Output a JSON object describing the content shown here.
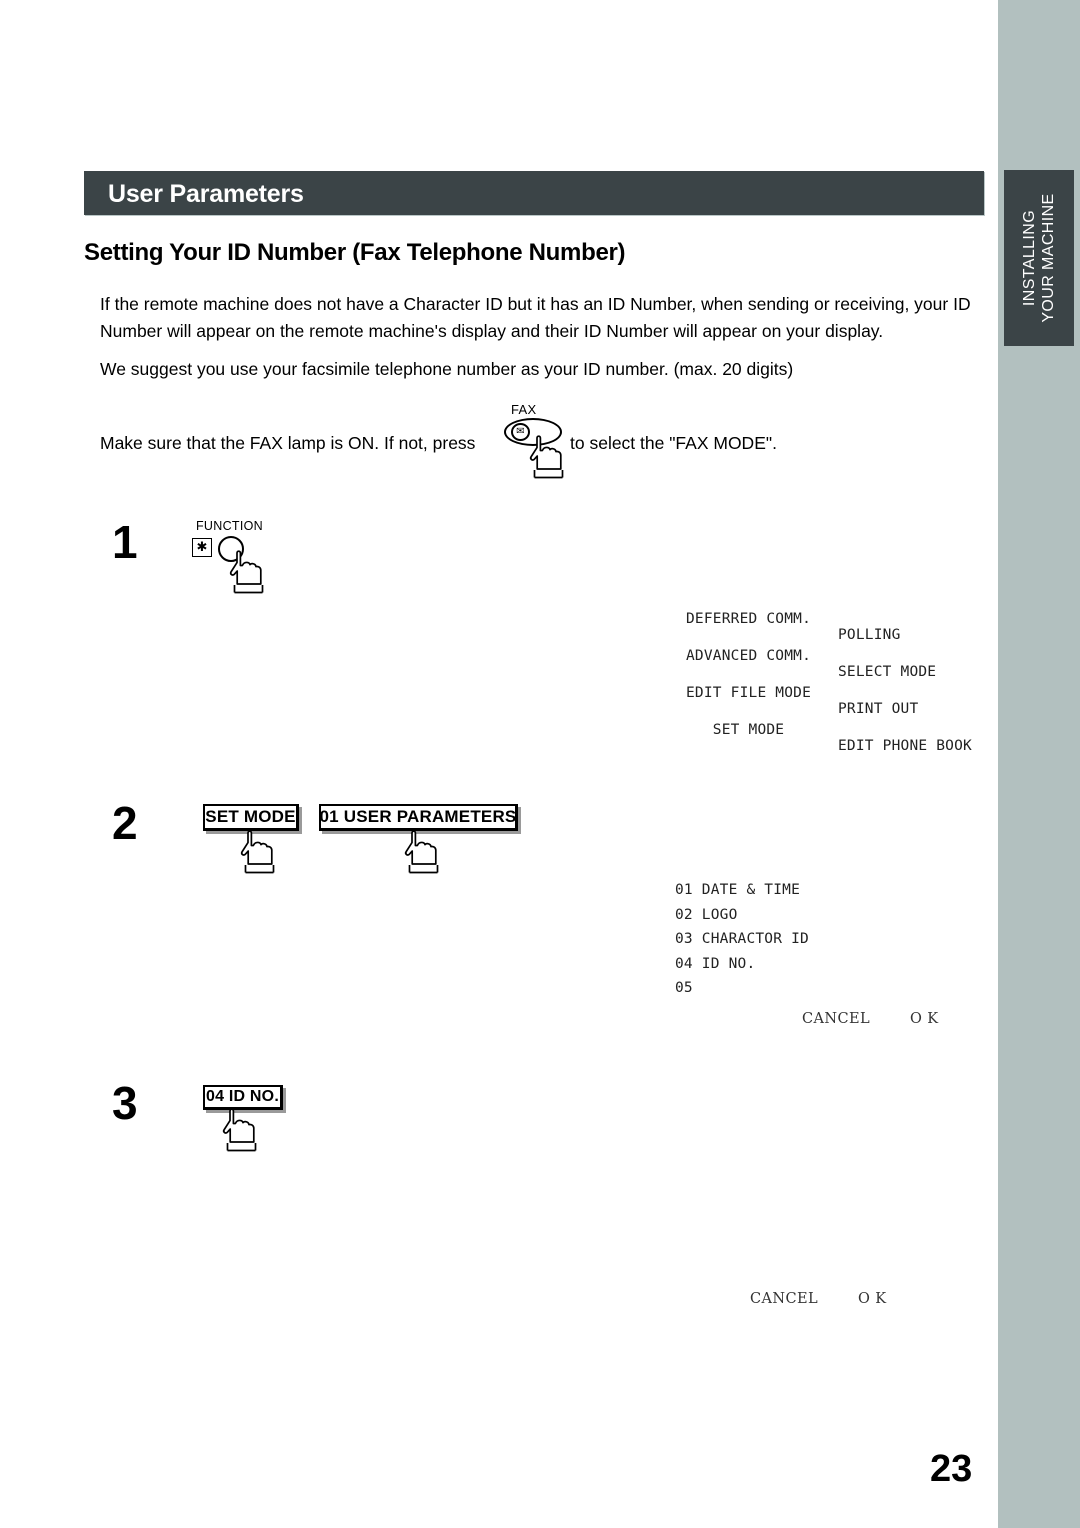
{
  "page": {
    "number": "23",
    "accent_dark": "#3b4447",
    "side_band_color": "#b2c0bf"
  },
  "side_tab": {
    "label": "INSTALLING\nYOUR MACHINE"
  },
  "header": {
    "title": "User Parameters"
  },
  "section": {
    "heading": "Setting Your ID Number (Fax Telephone Number)",
    "paragraph_1": "If the remote machine does not have a Character ID but it has an ID Number, when sending or receiving, your ID Number will appear on the remote machine's display and their ID Number will appear on your display.",
    "paragraph_2": "We suggest you use your facsimile telephone number as your ID number. (max. 20 digits)"
  },
  "fax_note": {
    "text_before": "Make sure that the FAX lamp is ON.  If not, press",
    "text_after": "to select the \"FAX MODE\".",
    "key_label": "FAX",
    "key_glyph": "✉"
  },
  "steps": {
    "one": {
      "number": "1",
      "key_label": "FUNCTION",
      "asterisk_glyph": "✱"
    },
    "two": {
      "number": "2",
      "key_set_mode": "SET MODE",
      "key_user_parameters": "01  USER PARAMETERS"
    },
    "three": {
      "number": "3",
      "key_id_no": "04 ID NO."
    }
  },
  "lcd_step1": {
    "rows": [
      {
        "left": "DEFERRED COMM.",
        "right": "POLLING"
      },
      {
        "left": "ADVANCED COMM.",
        "right": "SELECT MODE"
      },
      {
        "left": "EDIT FILE MODE",
        "right": "PRINT OUT"
      },
      {
        "left": "   SET MODE",
        "right": "EDIT PHONE BOOK"
      }
    ]
  },
  "lcd_step2": {
    "rows": [
      "01 DATE & TIME",
      "02 LOGO",
      "03 CHARACTOR ID",
      "04 ID NO.",
      "05"
    ],
    "cancel": "CANCEL",
    "ok": "O K"
  },
  "lcd_step3": {
    "cancel": "CANCEL",
    "ok": "O K"
  }
}
